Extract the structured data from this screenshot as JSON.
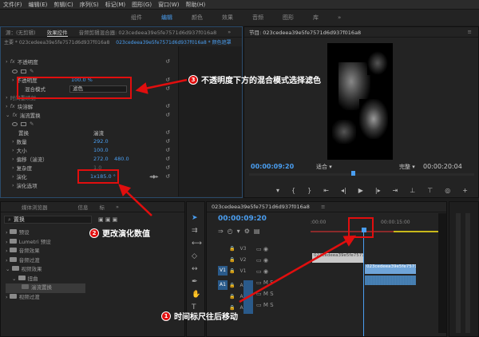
{
  "menu": [
    "文件(F)",
    "编辑(E)",
    "剪辑(C)",
    "序列(S)",
    "标记(M)",
    "图形(G)",
    "窗口(W)",
    "帮助(H)"
  ],
  "workspaces": [
    "组件",
    "编辑",
    "颜色",
    "效果",
    "音频",
    "图形",
    "库"
  ],
  "workspace_more": "»",
  "left_tabs": [
    "源：(无剪辑)",
    "效果控件",
    "音频剪辑混合器: 023cedeea39e5fe7571d6d937f016a8"
  ],
  "left_tabs_more": "»",
  "ec_header": {
    "master": "主要 * 023cedeea39e5fe7571d6d937f016a8",
    "clip": "023cedeea39e5fe7571d6d937f016a8 * 颜色遮罩"
  },
  "opacity": {
    "label": "不透明度",
    "blend_label": "混合模式",
    "blend_value": "滤色",
    "sub1": "不透明度",
    "sub1_val": "100.0 %",
    "sub2": "时间重映射"
  },
  "effects_rows": {
    "flip": "块溶解",
    "turb": "湍流置换",
    "displace": "置换",
    "displace_val": "湍流",
    "amount": "数量",
    "amount_val": "292.0",
    "size": "大小",
    "size_val": "100.0",
    "offset": "偏移（湍流）",
    "offset_x": "272.0",
    "offset_y": "480.0",
    "complexity": "复杂度",
    "complexity_val": "1.0",
    "evolution": "演化",
    "evolution_val": "1x185.0 °",
    "evolution_opts": "演化选项"
  },
  "program": {
    "title": "节目: 023cedeea39e5fe7571d6d937f016a8",
    "menu": "≡",
    "timecode": "00:00:09:20",
    "fit": "适合",
    "full": "完整",
    "duration": "00:00:20:04"
  },
  "callouts": {
    "c1_num": "1",
    "c1_text": "时间标尺往后移动",
    "c2_num": "2",
    "c2_text": "更改演化数值",
    "c3_num": "3",
    "c3_text": "不透明度下方的混合模式选择滤色"
  },
  "project": {
    "tabs": [
      "媒体浏览器",
      "信息",
      "标"
    ],
    "tabs_more": "»",
    "search": "置换",
    "items": [
      "预设",
      "Lumetri 预设",
      "音频效果",
      "音频过渡",
      "视频效果",
      "扭曲",
      "湍流置换",
      "视频过渡"
    ]
  },
  "timeline": {
    "title": "023cedeea39e5fe7571d6d937f016a8",
    "menu": "≡",
    "timecode": "00:00:09:20",
    "ruler": [
      ":00:00",
      "00:00:15:00"
    ],
    "tracks_v": [
      "V3",
      "V2",
      "V1"
    ],
    "tracks_a": [
      "A1",
      "A2",
      "A3"
    ],
    "v1_label": "V1",
    "a1_label": "A1",
    "clip_v2": "023cedeea39e5fe7571d6d937f016a8",
    "clip_v1": "023cedeea39e5fe7571d6d937f016a8"
  },
  "accent": "#4a9ef0",
  "red": "#e10e0e"
}
